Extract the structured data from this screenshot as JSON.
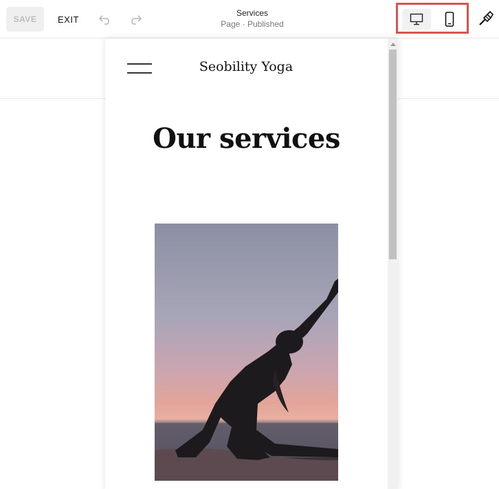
{
  "toolbar": {
    "save_label": "SAVE",
    "exit_label": "EXIT",
    "page_title": "Services",
    "page_status": "Page · Published"
  },
  "icons": {
    "undo": "undo-icon",
    "redo": "redo-icon",
    "desktop": "desktop-icon",
    "mobile": "mobile-phone-icon",
    "brush": "paint-brush-icon",
    "menu": "hamburger-menu-icon"
  },
  "preview": {
    "site_title": "Seobility Yoga",
    "heading": "Our services",
    "image_subject": "yoga-pose-sunset-photo"
  },
  "colors": {
    "highlight": "#d9534f",
    "save_bg": "#efefef",
    "save_text": "#bdbdbd"
  }
}
